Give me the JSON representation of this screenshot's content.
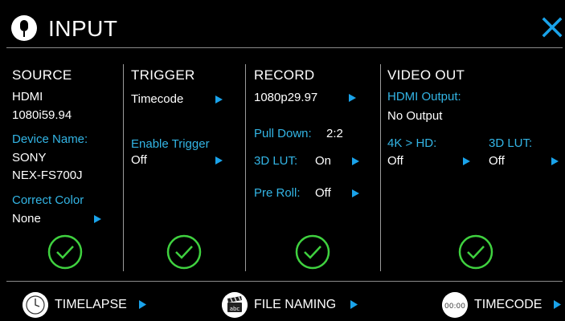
{
  "header": {
    "title": "INPUT",
    "icon": "microphone-icon",
    "close_icon": "close-icon"
  },
  "colors": {
    "accent": "#1aa3ea",
    "label": "#33b5e5",
    "check": "#3fd13f",
    "background": "#000000"
  },
  "source": {
    "heading": "SOURCE",
    "input": "HDMI",
    "format": "1080i59.94",
    "device_name_label": "Device Name:",
    "device_make": "SONY",
    "device_model": "NEX-FS700J",
    "correct_color_label": "Correct Color",
    "correct_color_value": "None"
  },
  "trigger": {
    "heading": "TRIGGER",
    "mode": "Timecode",
    "enable_trigger_label": "Enable Trigger",
    "enable_trigger_value": "Off"
  },
  "record": {
    "heading": "RECORD",
    "format": "1080p29.97",
    "pull_down_label": "Pull Down:",
    "pull_down_value": "2:2",
    "lut_label": "3D LUT:",
    "lut_value": "On",
    "pre_roll_label": "Pre Roll:",
    "pre_roll_value": "Off"
  },
  "video_out": {
    "heading": "VIDEO OUT",
    "hdmi_output_label": "HDMI Output:",
    "hdmi_output_value": "No Output",
    "downconvert_label": "4K > HD:",
    "downconvert_value": "Off",
    "lut_label": "3D LUT:",
    "lut_value": "Off"
  },
  "footer": {
    "timelapse": {
      "label": "TIMELAPSE",
      "icon": "clock-icon"
    },
    "file_naming": {
      "label": "FILE NAMING",
      "icon": "clapperboard-icon",
      "icon_text": "abc"
    },
    "timecode": {
      "label": "TIMECODE",
      "icon": "timecode-icon",
      "icon_text": "00:00"
    }
  }
}
